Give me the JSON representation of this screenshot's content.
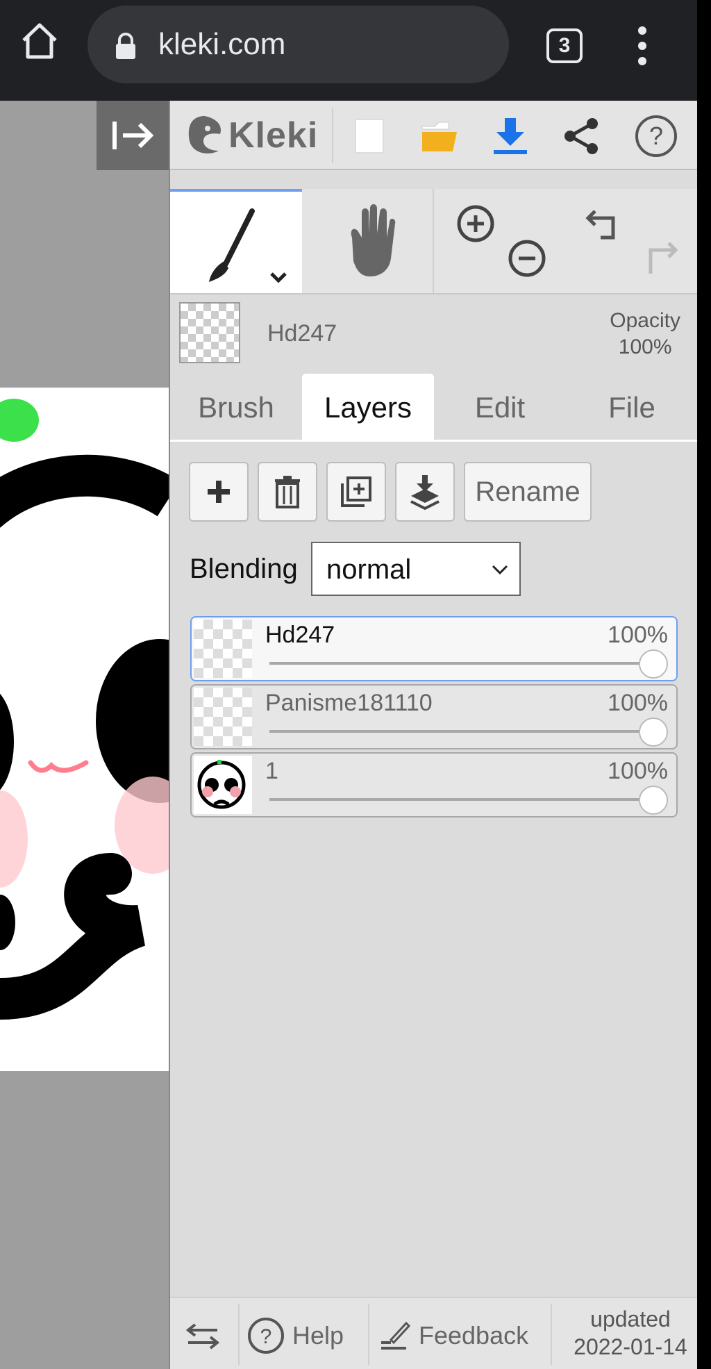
{
  "browser": {
    "url": "kleki.com",
    "tab_count": "3"
  },
  "app": {
    "logo_text": "Kleki"
  },
  "brush_info": {
    "layer_name": "Hd247",
    "opacity_title": "Opacity",
    "opacity_value": "100%"
  },
  "tabs": [
    {
      "label": "Brush"
    },
    {
      "label": "Layers"
    },
    {
      "label": "Edit"
    },
    {
      "label": "File"
    }
  ],
  "layers_panel": {
    "rename_label": "Rename",
    "blending_label": "Blending",
    "blending_value": "normal",
    "layers": [
      {
        "name": "Hd247",
        "opacity": "100%",
        "selected": true
      },
      {
        "name": "Panisme181110",
        "opacity": "100%",
        "selected": false
      },
      {
        "name": "1",
        "opacity": "100%",
        "selected": false
      }
    ]
  },
  "footer": {
    "help_label": "Help",
    "feedback_label": "Feedback",
    "updated_line1": "updated",
    "updated_line2": "2022-01-14"
  },
  "colors": {
    "accent": "#6d9ef0",
    "download_blue": "#1a73e8",
    "folder_yellow": "#f2b01e"
  },
  "icons": [
    "home-icon",
    "lock-icon",
    "kebab-menu-icon",
    "collapse-panel-icon",
    "new-image-icon",
    "open-folder-icon",
    "download-icon",
    "share-icon",
    "help-circle-icon",
    "brush-icon",
    "hand-icon",
    "zoom-in-icon",
    "zoom-out-icon",
    "undo-icon",
    "redo-icon",
    "plus-icon",
    "trash-icon",
    "duplicate-icon",
    "merge-down-icon",
    "chevron-down-icon",
    "swap-icon",
    "feedback-icon"
  ]
}
